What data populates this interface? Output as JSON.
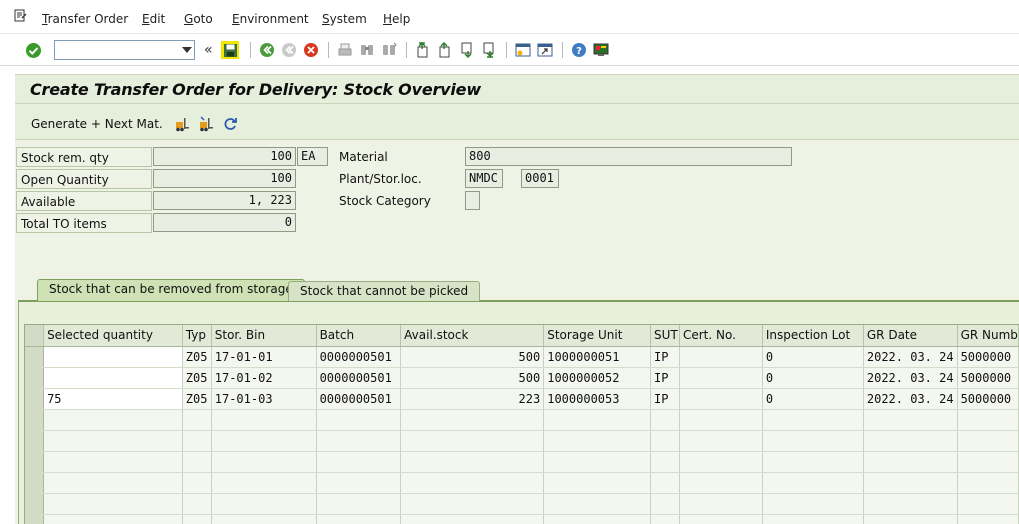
{
  "menu": {
    "items": [
      "Transfer Order",
      "Edit",
      "Goto",
      "Environment",
      "System",
      "Help"
    ]
  },
  "toolbar": {
    "command_field_value": "",
    "icons": [
      "enter-icon",
      "save-icon",
      "back-icon",
      "exit-icon",
      "cancel-icon",
      "print-icon",
      "find-icon",
      "find-next-icon",
      "first-page-icon",
      "previous-page-icon",
      "next-page-icon",
      "last-page-icon",
      "create-session-icon",
      "shortcut-icon",
      "help-icon",
      "customize-layout-icon"
    ],
    "colors": {
      "enter": "#3a9a2a",
      "save_highlight": "#f5e600",
      "exit": "#c94a2e",
      "cancel": "#d6391f"
    }
  },
  "page": {
    "title": "Create Transfer Order for Delivery: Stock Overview",
    "generate_next_label": "Generate + Next Mat.",
    "app_icons": [
      "forklift-icon",
      "forklift-alt-icon",
      "refresh-icon"
    ]
  },
  "form": {
    "stock_rem_qty_label": "Stock rem. qty",
    "stock_rem_qty_value": "100",
    "stock_rem_qty_unit": "EA",
    "open_quantity_label": "Open Quantity",
    "open_quantity_value": "100",
    "available_label": "Available",
    "available_value": "1, 223",
    "total_to_items_label": "Total TO items",
    "total_to_items_value": "0",
    "material_label": "Material",
    "material_value": "800",
    "plant_stor_loc_label": "Plant/Stor.loc.",
    "plant_value": "NMDC",
    "stor_loc_value": "0001",
    "stock_category_label": "Stock Category",
    "stock_category_value": ""
  },
  "tabs": [
    {
      "label": "Stock that can be removed from storage",
      "active": true
    },
    {
      "label": "Stock that cannot be picked",
      "active": false
    }
  ],
  "table": {
    "columns": [
      "Selected quantity",
      "Typ",
      "Stor. Bin",
      "Batch",
      "Avail.stock",
      "Storage Unit",
      "SUT",
      "Cert. No.",
      "Inspection Lot",
      "GR Date",
      "GR Numb"
    ],
    "rows": [
      {
        "selected_quantity": "",
        "typ": "Z05",
        "stor_bin": "17-01-01",
        "batch": "0000000501",
        "avail_stock": "500",
        "storage_unit": "1000000051",
        "sut": "IP",
        "cert_no": "",
        "inspection_lot": "0",
        "gr_date": "2022. 03. 24",
        "gr_number": "5000000"
      },
      {
        "selected_quantity": "",
        "typ": "Z05",
        "stor_bin": "17-01-02",
        "batch": "0000000501",
        "avail_stock": "500",
        "storage_unit": "1000000052",
        "sut": "IP",
        "cert_no": "",
        "inspection_lot": "0",
        "gr_date": "2022. 03. 24",
        "gr_number": "5000000"
      },
      {
        "selected_quantity": "75",
        "typ": "Z05",
        "stor_bin": "17-01-03",
        "batch": "0000000501",
        "avail_stock": "223",
        "storage_unit": "1000000053",
        "sut": "IP",
        "cert_no": "",
        "inspection_lot": "0",
        "gr_date": "2022. 03. 24",
        "gr_number": "5000000"
      }
    ]
  }
}
